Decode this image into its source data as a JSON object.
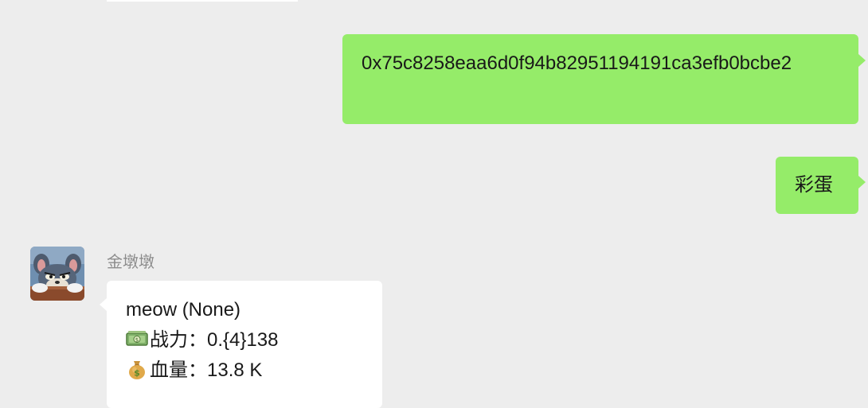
{
  "conversation": {
    "messages": [
      {
        "direction": "outgoing",
        "text": "0x75c8258eaa6d0f94b82951194191ca3efb0bcbe2"
      },
      {
        "direction": "outgoing",
        "text": "彩蛋"
      },
      {
        "direction": "incoming",
        "sender": "金墩墩",
        "avatar_icon": "tom-cat-avatar",
        "lines": [
          {
            "icon": "",
            "text": "meow (None)"
          },
          {
            "icon": "money-banknote-icon",
            "label": "战力：",
            "value": "0.{4}138"
          },
          {
            "icon": "money-bag-icon",
            "label": "血量：",
            "value": "13.8 K"
          }
        ]
      }
    ]
  },
  "colors": {
    "background": "#ededed",
    "outgoing_bubble": "#95ec69",
    "incoming_bubble": "#ffffff",
    "sender_name": "#8c8c8c"
  }
}
